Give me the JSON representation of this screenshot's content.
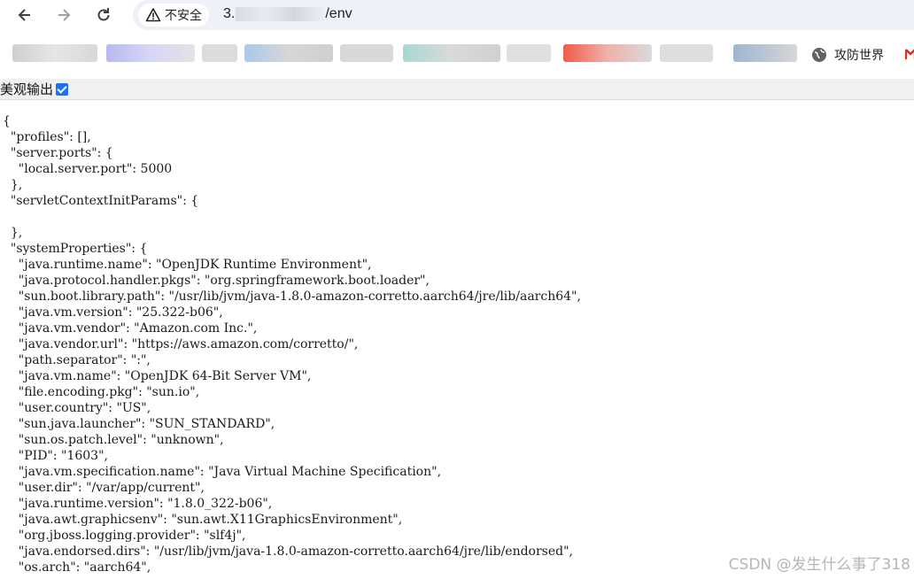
{
  "browser": {
    "security_label": "不安全",
    "url_prefix": "3.",
    "url_suffix": "/env",
    "bookmark_visible": "攻防世界"
  },
  "page": {
    "pretty_label": "美观输出",
    "pretty_checked": true
  },
  "json_lines": [
    "{",
    "  \"profiles\": [],",
    "  \"server.ports\": {",
    "    \"local.server.port\": 5000",
    "  },",
    "  \"servletContextInitParams\": {",
    "",
    "  },",
    "  \"systemProperties\": {",
    "    \"java.runtime.name\": \"OpenJDK Runtime Environment\",",
    "    \"java.protocol.handler.pkgs\": \"org.springframework.boot.loader\",",
    "    \"sun.boot.library.path\": \"/usr/lib/jvm/java-1.8.0-amazon-corretto.aarch64/jre/lib/aarch64\",",
    "    \"java.vm.version\": \"25.322-b06\",",
    "    \"java.vm.vendor\": \"Amazon.com Inc.\",",
    "    \"java.vendor.url\": \"https://aws.amazon.com/corretto/\",",
    "    \"path.separator\": \":\",",
    "    \"java.vm.name\": \"OpenJDK 64-Bit Server VM\",",
    "    \"file.encoding.pkg\": \"sun.io\",",
    "    \"user.country\": \"US\",",
    "    \"sun.java.launcher\": \"SUN_STANDARD\",",
    "    \"sun.os.patch.level\": \"unknown\",",
    "    \"PID\": \"1603\",",
    "    \"java.vm.specification.name\": \"Java Virtual Machine Specification\",",
    "    \"user.dir\": \"/var/app/current\",",
    "    \"java.runtime.version\": \"1.8.0_322-b06\",",
    "    \"java.awt.graphicsenv\": \"sun.awt.X11GraphicsEnvironment\",",
    "    \"org.jboss.logging.provider\": \"slf4j\",",
    "    \"java.endorsed.dirs\": \"/usr/lib/jvm/java-1.8.0-amazon-corretto.aarch64/jre/lib/endorsed\",",
    "    \"os.arch\": \"aarch64\","
  ],
  "watermark": "CSDN @发生什么事了318"
}
